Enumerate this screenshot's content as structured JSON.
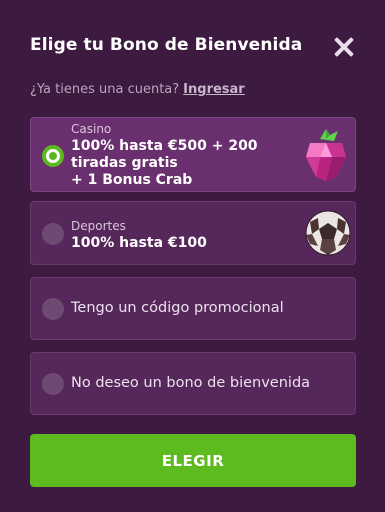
{
  "header": {
    "title": "Elige tu Bono de Bienvenida",
    "close_icon": "close-icon"
  },
  "account": {
    "question": "¿Ya tienes una cuenta?",
    "login_link": "Ingresar"
  },
  "options": [
    {
      "category": "Casino",
      "line1": "100% hasta €500 + 200",
      "line2": "tiradas gratis",
      "line3": "+ 1 Bonus Crab",
      "selected": true,
      "icon": "gem-raspberry-icon"
    },
    {
      "category": "Deportes",
      "line1": "100% hasta €100",
      "selected": false,
      "icon": "soccer-ball-icon"
    },
    {
      "label": "Tengo un código promocional",
      "selected": false
    },
    {
      "label": "No deseo un bono de bienvenida",
      "selected": false
    }
  ],
  "cta": {
    "label": "ELEGIR"
  },
  "colors": {
    "background": "#3d1a3f",
    "option_bg": "#56275a",
    "selected_bg": "#6a2f6e",
    "accent_green": "#5dba1f"
  }
}
